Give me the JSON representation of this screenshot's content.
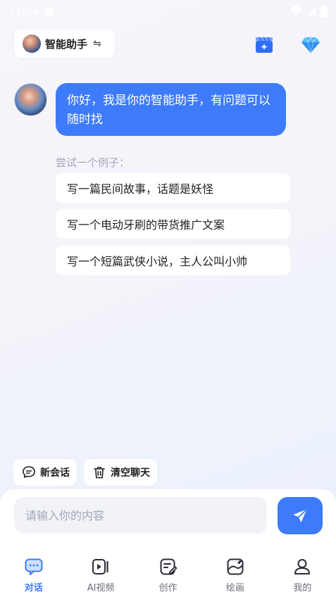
{
  "status_bar": {
    "time": "11:04"
  },
  "header": {
    "agent_name": "智能助手",
    "switch_glyph": "⇋",
    "icons": [
      "clapperboard-icon",
      "diamond-icon"
    ]
  },
  "chat": {
    "greeting": "你好，我是你的智能助手，有问题可以随时找",
    "examples_label": "尝试一个例子：",
    "examples": [
      "写一篇民间故事，话题是妖怪",
      "写一个电动牙刷的带货推广文案",
      "写一个短篇武侠小说，主人公叫小帅"
    ]
  },
  "actions": {
    "new_chat": "新会话",
    "clear_chat": "清空聊天"
  },
  "composer": {
    "placeholder": "请输入你的内容"
  },
  "tabbar": {
    "tabs": [
      {
        "label": "对话",
        "icon": "chat-icon",
        "active": true
      },
      {
        "label": "AI视频",
        "icon": "video-icon",
        "active": false
      },
      {
        "label": "创作",
        "icon": "edit-icon",
        "active": false
      },
      {
        "label": "绘画",
        "icon": "painting-icon",
        "active": false
      },
      {
        "label": "我的",
        "icon": "user-icon",
        "active": false
      }
    ]
  },
  "colors": {
    "accent": "#3d7bfa",
    "text_primary": "#1f1f1f",
    "text_muted": "#a4a8b4"
  }
}
